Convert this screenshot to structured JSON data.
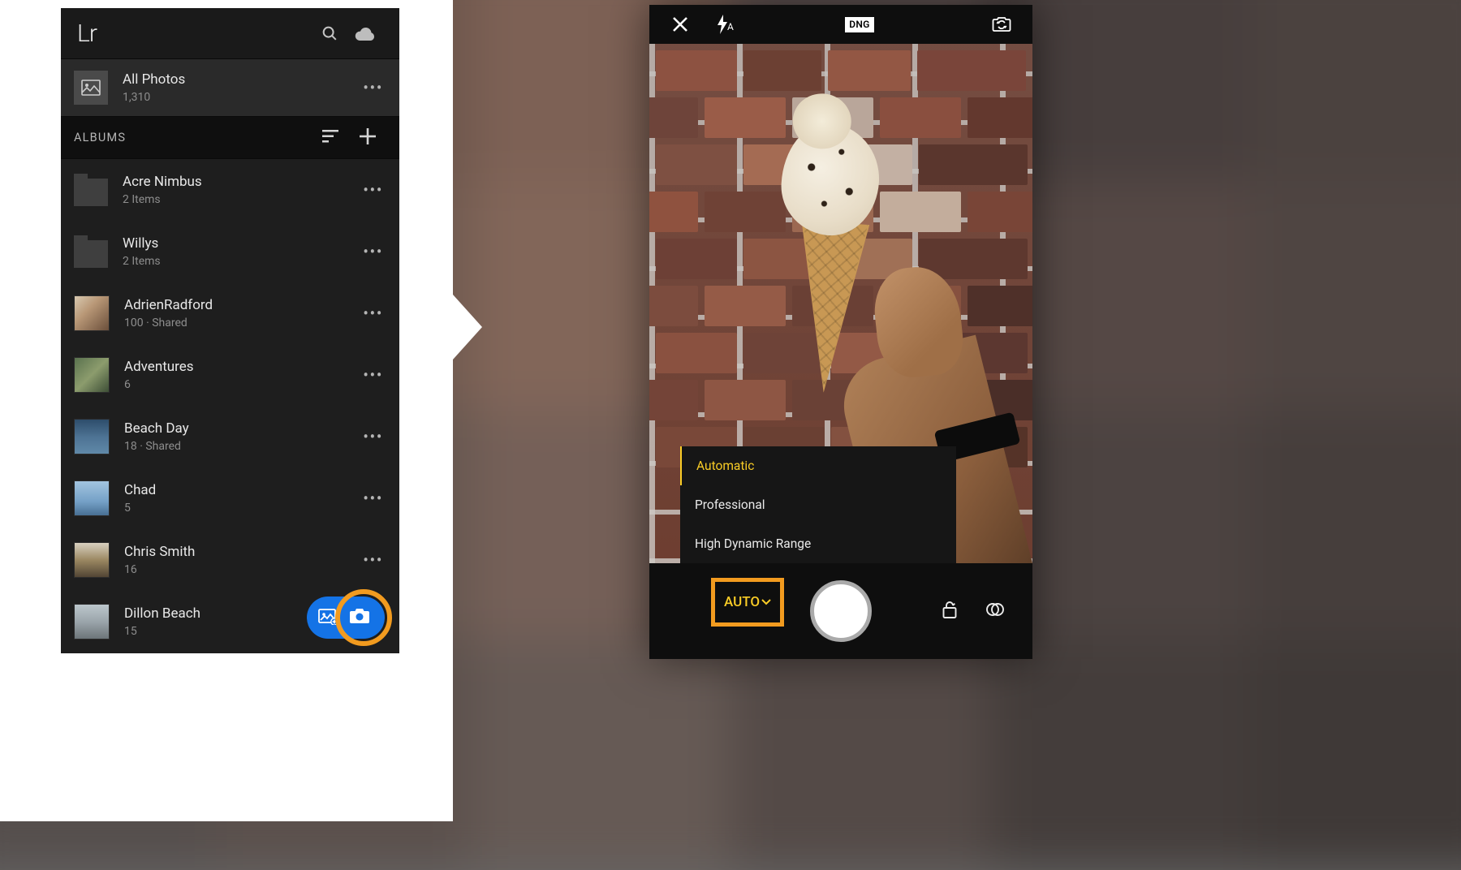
{
  "left": {
    "logo": "Lr",
    "allPhotos": {
      "title": "All Photos",
      "count": "1,310"
    },
    "albumsHeader": "ALBUMS",
    "albums": [
      {
        "name": "Acre Nimbus",
        "sub": "2 Items",
        "type": "folder"
      },
      {
        "name": "Willys",
        "sub": "2 Items",
        "type": "folder"
      },
      {
        "name": "AdrienRadford",
        "sub": "100 · Shared",
        "type": "album"
      },
      {
        "name": "Adventures",
        "sub": "6",
        "type": "album"
      },
      {
        "name": "Beach Day",
        "sub": "18 · Shared",
        "type": "album"
      },
      {
        "name": "Chad",
        "sub": "5",
        "type": "album"
      },
      {
        "name": "Chris Smith",
        "sub": "16",
        "type": "album"
      },
      {
        "name": "Dillon Beach",
        "sub": "15",
        "type": "album"
      }
    ]
  },
  "right": {
    "dng": "DNG",
    "flashMode": "A",
    "modes": [
      "Automatic",
      "Professional",
      "High Dynamic Range"
    ],
    "activeMode": "Automatic",
    "autoLabel": "AUTO"
  },
  "colors": {
    "accentBlue": "#1473e6",
    "highlightOrange": "#f29b1f",
    "modeYellow": "#f9cc26"
  }
}
